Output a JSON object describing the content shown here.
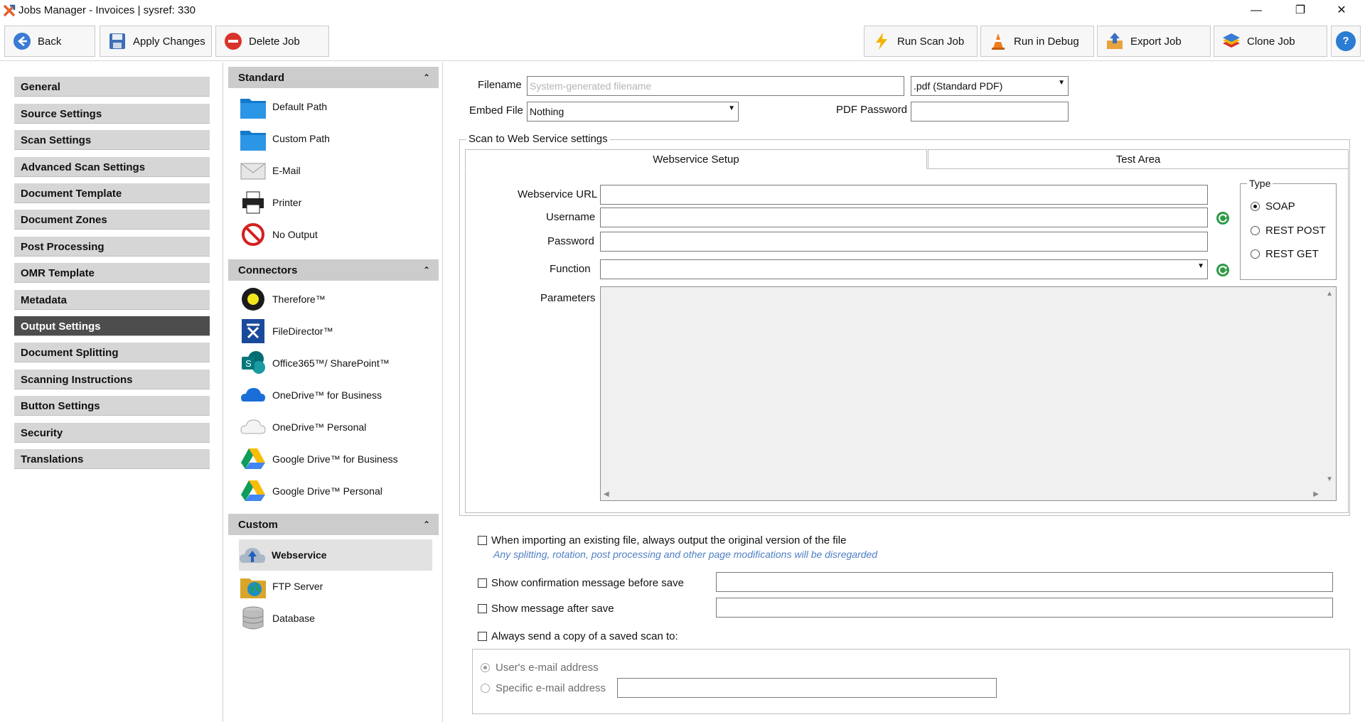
{
  "window": {
    "title": "Jobs Manager - Invoices  |  sysref: 330",
    "controls": {
      "minimize": "—",
      "restore": "❐",
      "close": "✕"
    }
  },
  "toolbar": {
    "back": "Back",
    "apply": "Apply Changes",
    "delete": "Delete Job",
    "run_scan": "Run Scan Job",
    "run_debug": "Run in Debug",
    "export": "Export Job",
    "clone": "Clone Job",
    "help": "?"
  },
  "nav": {
    "items": [
      "General",
      "Source Settings",
      "Scan Settings",
      "Advanced Scan Settings",
      "Document Template",
      "Document Zones",
      "Post Processing",
      "OMR Template",
      "Metadata",
      "Output Settings",
      "Document Splitting",
      "Scanning Instructions",
      "Button Settings",
      "Security",
      "Translations"
    ],
    "active_index": 9
  },
  "outputs": {
    "standard": {
      "title": "Standard",
      "items": [
        "Default Path",
        "Custom Path",
        "E-Mail",
        "Printer",
        "No Output"
      ]
    },
    "connectors": {
      "title": "Connectors",
      "items": [
        "Therefore™",
        "FileDirector™",
        "Office365™/ SharePoint™",
        "OneDrive™ for Business",
        "OneDrive™ Personal",
        "Google Drive™ for Business",
        "Google Drive™ Personal"
      ]
    },
    "custom": {
      "title": "Custom",
      "items": [
        "Webservice",
        "FTP Server",
        "Database"
      ],
      "selected": "Webservice"
    }
  },
  "form": {
    "filename_label": "Filename",
    "filename_placeholder": "System-generated filename",
    "format_value": ".pdf (Standard PDF)",
    "embed_label": "Embed File",
    "embed_value": "Nothing",
    "pdf_password_label": "PDF Password",
    "ws_group_title": "Scan to Web Service settings",
    "tabs": [
      "Webservice Setup",
      "Test Area"
    ],
    "ws_url_label": "Webservice URL",
    "username_label": "Username",
    "password_label": "Password",
    "function_label": "Function",
    "parameters_label": "Parameters",
    "type_title": "Type",
    "type_options": [
      "SOAP",
      "REST POST",
      "REST GET"
    ],
    "type_selected": "SOAP"
  },
  "options": {
    "import_original": "When importing an existing file, always output the original version of the file",
    "import_note": "Any splitting, rotation, post processing and other page modifications will be disregarded",
    "confirm_before_save": "Show confirmation message before save",
    "message_after_save": "Show message after save",
    "send_copy": "Always send a copy of a saved scan to:",
    "recipients": [
      "User's e-mail address",
      "Specific e-mail address"
    ],
    "recipient_selected": "User's e-mail address"
  },
  "colors": {
    "nav_active": "#4d4d4d",
    "nav_item": "#d6d6d6",
    "section_header": "#cccccc",
    "note_text": "#4e7fc4",
    "accent_green": "#2e9b46"
  }
}
